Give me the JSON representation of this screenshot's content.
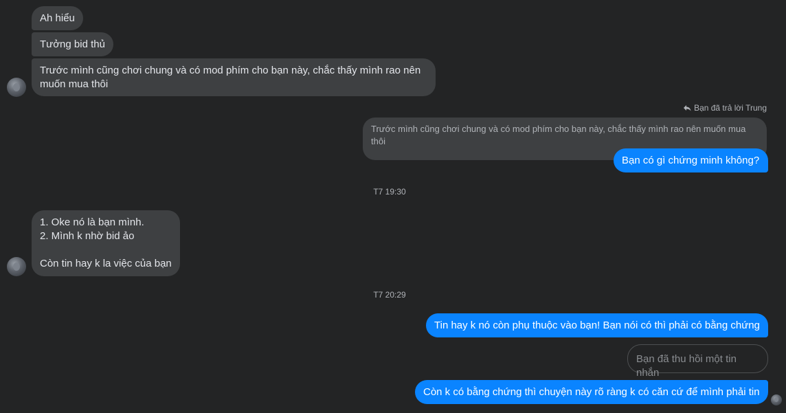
{
  "incoming_group_1": [
    "Ah hiểu",
    "Tưởng bid thủ",
    "Trước mình cũng chơi chung và có mod phím cho bạn này, chắc thấy mình rao nên\nmuốn mua thôi"
  ],
  "reply": {
    "label": "Bạn đã trả lời Trung",
    "quoted_text": "Trước mình cũng chơi chung và có mod phím cho bạn này, chắc thấy mình rao nên muốn mua\nthôi",
    "message": "Bạn có gì chứng minh không?"
  },
  "timestamps": {
    "first": "T7 19:30",
    "second": "T7 20:29"
  },
  "incoming_group_2": "1. Oke nó là bạn mình.\n2. Mình k nhờ bid ảo\n\nCòn tin hay k la việc của bạn",
  "outgoing_group_2": {
    "message_1": "Tin hay k nó còn phụ thuộc vào bạn! Bạn nói có thì phải có bằng chứng",
    "recalled": "Bạn đã thu hồi một tin nhắn",
    "message_2": "Còn k có bằng chứng thì chuyện này rõ ràng k có căn cứ để mình phải tin"
  },
  "colors": {
    "background": "#232425",
    "incoming_bubble": "#3e4042",
    "outgoing_bubble": "#0a84ff"
  }
}
